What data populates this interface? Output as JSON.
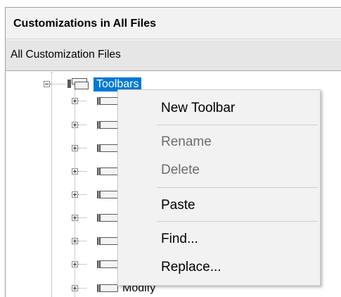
{
  "panel": {
    "header": "Customizations in All Files",
    "subheader": "All Customization Files"
  },
  "tree": {
    "root": {
      "label": "Toolbars",
      "expanded": true,
      "selected": true,
      "icon": "toolbars-group-icon"
    },
    "children": [
      {
        "label": "",
        "expander": "plus",
        "icon": "toolbar-icon"
      },
      {
        "label": "",
        "expander": "plus",
        "icon": "toolbar-icon"
      },
      {
        "label": "",
        "expander": "plus",
        "icon": "toolbar-icon"
      },
      {
        "label": "",
        "expander": "plus",
        "icon": "toolbar-icon"
      },
      {
        "label": "",
        "expander": "plus",
        "icon": "toolbar-icon"
      },
      {
        "label": "",
        "expander": "plus",
        "icon": "toolbar-icon"
      },
      {
        "label": "",
        "expander": "plus",
        "icon": "toolbar-icon"
      },
      {
        "label": "",
        "expander": "plus",
        "icon": "toolbar-icon"
      },
      {
        "label": "Modify",
        "expander": "plus",
        "icon": "toolbar-icon"
      }
    ]
  },
  "context_menu": {
    "items": [
      {
        "label": "New Toolbar",
        "enabled": true
      },
      {
        "separator": true
      },
      {
        "label": "Rename",
        "enabled": false
      },
      {
        "label": "Delete",
        "enabled": false
      },
      {
        "separator": true
      },
      {
        "label": "Paste",
        "enabled": true
      },
      {
        "separator": true
      },
      {
        "label": "Find...",
        "enabled": true
      },
      {
        "label": "Replace...",
        "enabled": true
      }
    ]
  },
  "colors": {
    "selection": "#0078d7",
    "menu_background": "#f2f2f2",
    "disabled_text": "#6d6d6d",
    "header_background": "#f2f2f2",
    "subheader_background": "#e6e6e6"
  }
}
